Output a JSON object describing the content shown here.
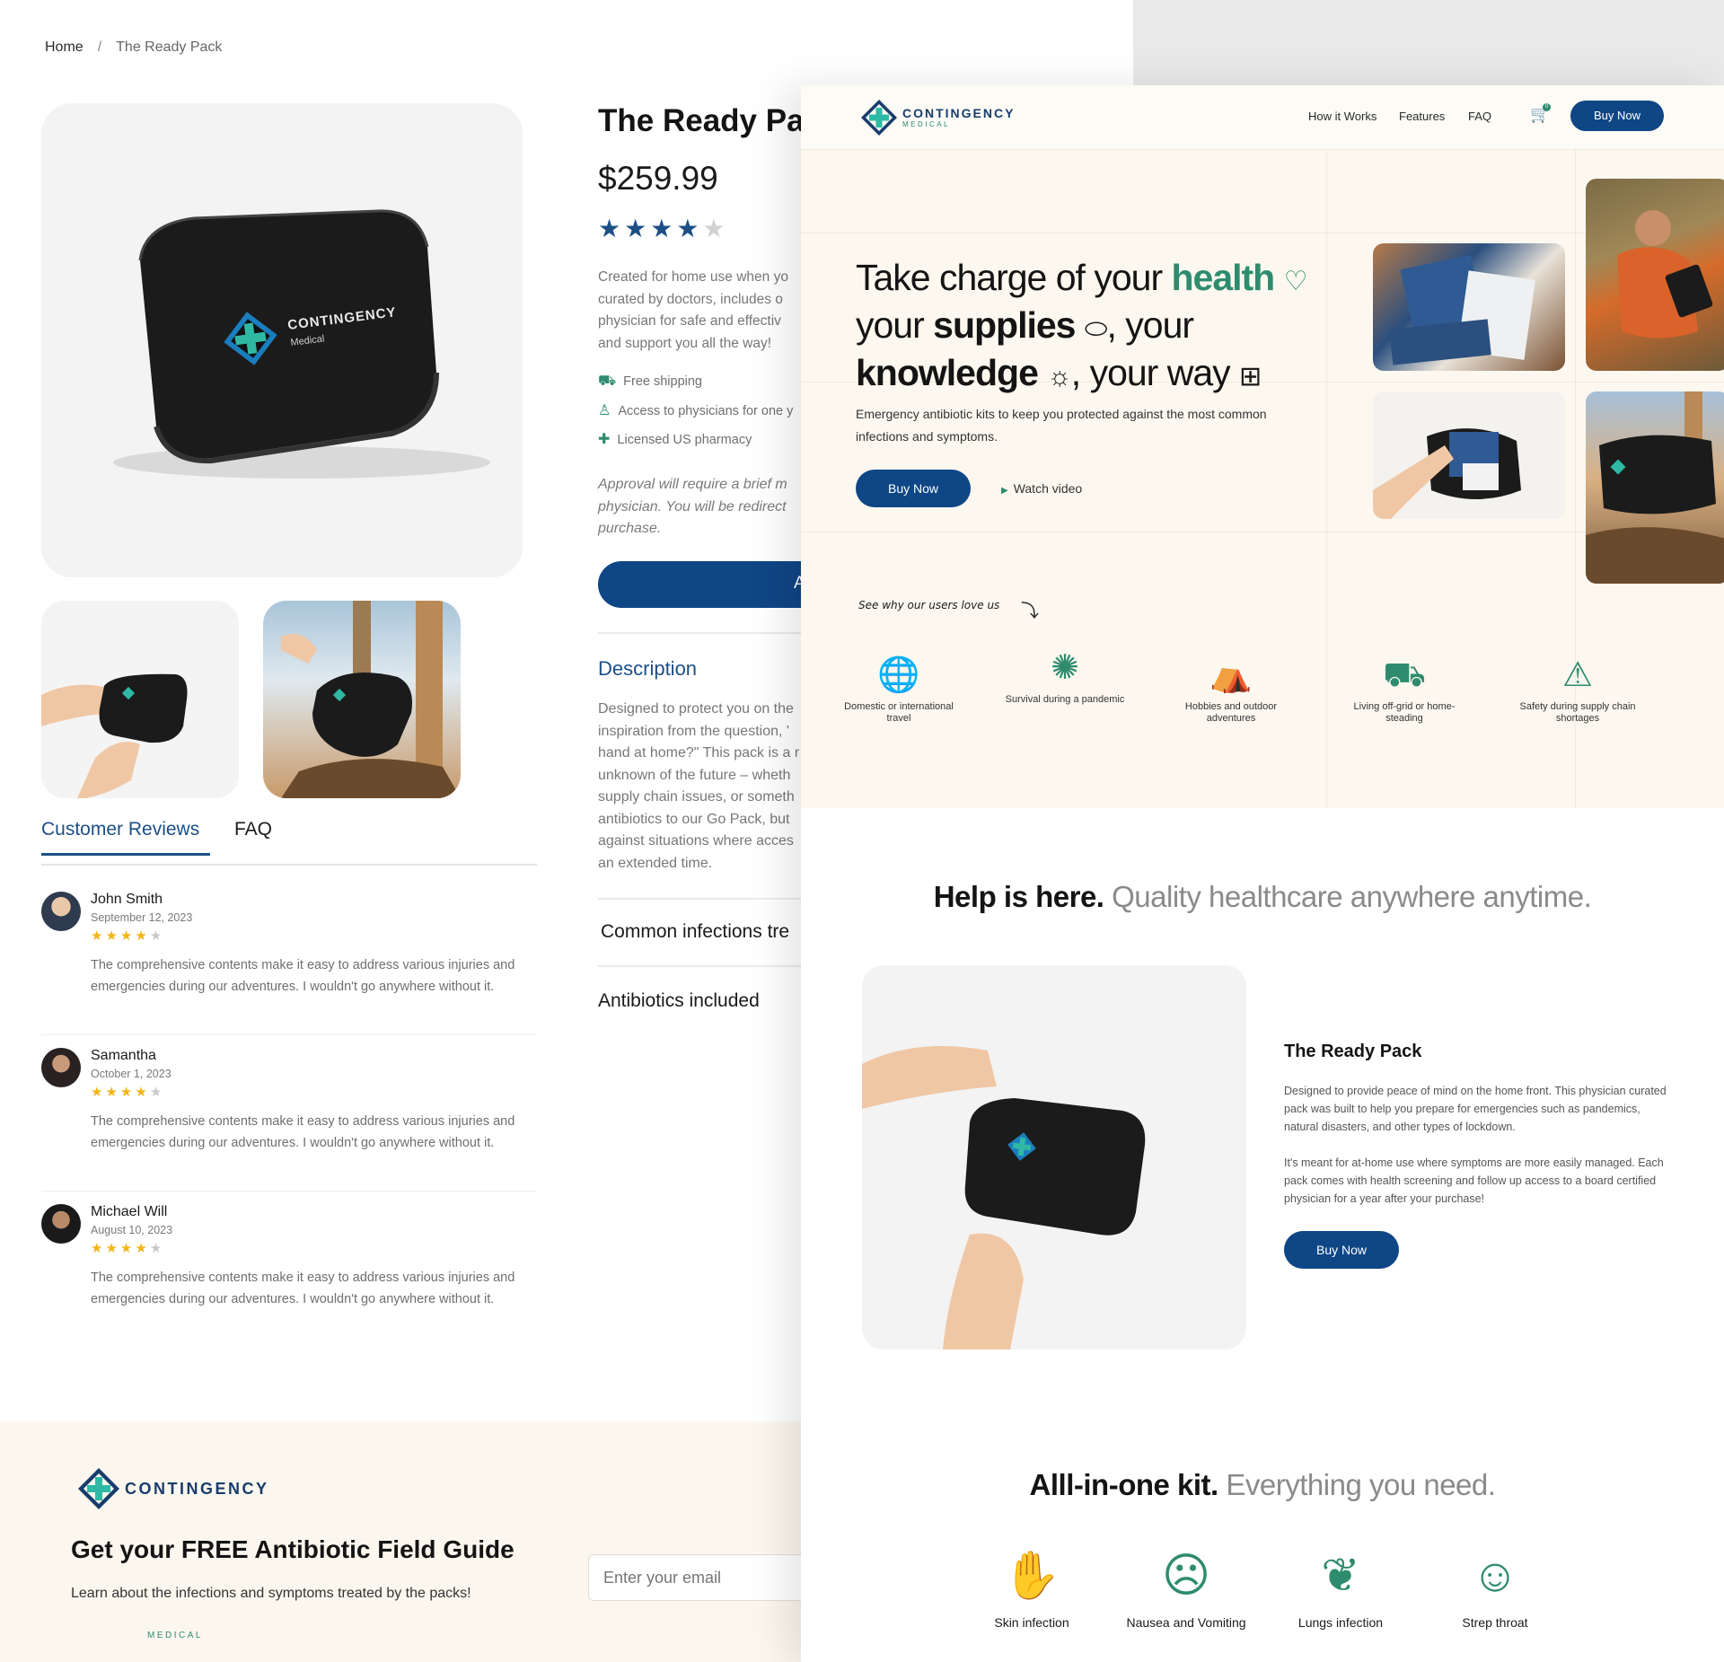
{
  "back_page": {
    "breadcrumb": {
      "home": "Home",
      "separator": "/",
      "current": "The Ready Pack"
    },
    "product": {
      "title": "The Ready Pa",
      "price": "$259.99",
      "rating": 4,
      "rating_max": 5,
      "description_lines": [
        "Created for home use when yo",
        "curated by doctors, includes o",
        "physician for safe and effectiv",
        "and support you all the way!"
      ],
      "features": [
        {
          "icon": "truck-icon",
          "label": "Free shipping"
        },
        {
          "icon": "user-icon",
          "label": "Access to physicians for one y"
        },
        {
          "icon": "cross-icon",
          "label": "Licensed US pharmacy"
        }
      ],
      "approval_lines": [
        "Approval will require a brief m",
        "physician. You will be redirect",
        "purchase."
      ],
      "button_label": "A",
      "description_heading": "Description",
      "description_text_lines": [
        "Designed to protect you on the",
        "inspiration from the question, '",
        "hand at home?\" This pack is a r",
        "unknown of the future – wheth",
        "supply chain issues, or someth",
        "antibiotics to our Go Pack, but",
        "against situations where acces",
        "an extended time."
      ],
      "accordion": [
        "Common infections tre",
        "Antibiotics included"
      ]
    },
    "tabs": {
      "reviews": "Customer Reviews",
      "faq": "FAQ"
    },
    "reviews": [
      {
        "name": "John Smith",
        "date": "September 12, 2023",
        "rating": 4,
        "text": "The comprehensive contents make it easy to address various injuries and emergencies during our adventures. I wouldn't go anywhere without it."
      },
      {
        "name": "Samantha",
        "date": "October 1, 2023",
        "rating": 4,
        "text": "The comprehensive contents make it easy to address various injuries and emergencies during our adventures. I wouldn't go anywhere without it."
      },
      {
        "name": "Michael Will",
        "date": "August 10, 2023",
        "rating": 4,
        "text": "The comprehensive contents make it easy to address various injuries and emergencies during our adventures. I wouldn't go anywhere without it."
      }
    ],
    "guide": {
      "brand": "CONTINGENCY",
      "brand_sub": "MEDICAL",
      "title": "Get your FREE Antibiotic Field Guide",
      "subtitle": "Learn about the infections and symptoms treated by the packs!",
      "email_placeholder": "Enter your email"
    },
    "case_brand": "CONTINGENCY",
    "case_sub": "Medical"
  },
  "front_page": {
    "nav": {
      "brand": "CONTINGENCY",
      "brand_sub": "MEDICAL",
      "links": [
        "How it Works",
        "Features",
        "FAQ"
      ],
      "cart_count": "0",
      "buy_label": "Buy Now"
    },
    "hero": {
      "line1_a": "Take charge of your ",
      "line1_b": "health",
      "line2_a": "your ",
      "line2_b": "supplies",
      "line2_c": ", your",
      "line3_a": "knowledge",
      "line3_b": ", your way",
      "lead": "Emergency antibiotic kits to keep you protected against the most common infections and symptoms.",
      "buy_label": "Buy Now",
      "watch_label": "Watch video",
      "why_label": "See why our users love us"
    },
    "use_cases": [
      {
        "icon": "globe-plane-icon",
        "label": "Domestic or international travel"
      },
      {
        "icon": "virus-icon",
        "label": "Survival during a pandemic"
      },
      {
        "icon": "tent-icon",
        "label": "Hobbies and outdoor adventures"
      },
      {
        "icon": "truck-icon",
        "label": "Living off-grid or home-steading"
      },
      {
        "icon": "warning-icon",
        "label": "Safety during supply chain shortages"
      }
    ],
    "help": {
      "bold": "Help is here.",
      "gray": " Quality healthcare anywhere anytime."
    },
    "kit": {
      "title": "The Ready Pack",
      "p1": "Designed to provide peace of mind on the home front. This physician curated pack was built to help you prepare for emergencies such as pandemics, natural disasters, and other types of lockdown.",
      "p2": "It's meant for at-home use where symptoms are more easily managed. Each pack comes with health screening and follow up access to a board certified physician for a year after your purchase!",
      "buy_label": "Buy Now"
    },
    "allin": {
      "bold": "Alll-in-one kit.",
      "gray": " Everything you need."
    },
    "infections": [
      {
        "icon": "skin-infection-icon",
        "label": "Skin infection"
      },
      {
        "icon": "nausea-icon",
        "label": "Nausea and Vomiting"
      },
      {
        "icon": "lungs-icon",
        "label": "Lungs infection"
      },
      {
        "icon": "strep-throat-icon",
        "label": "Strep throat"
      }
    ]
  },
  "colors": {
    "navy": "#0f4685",
    "green": "#2e8b6e",
    "cream": "#fcf8ef",
    "star": "#f3b416"
  }
}
